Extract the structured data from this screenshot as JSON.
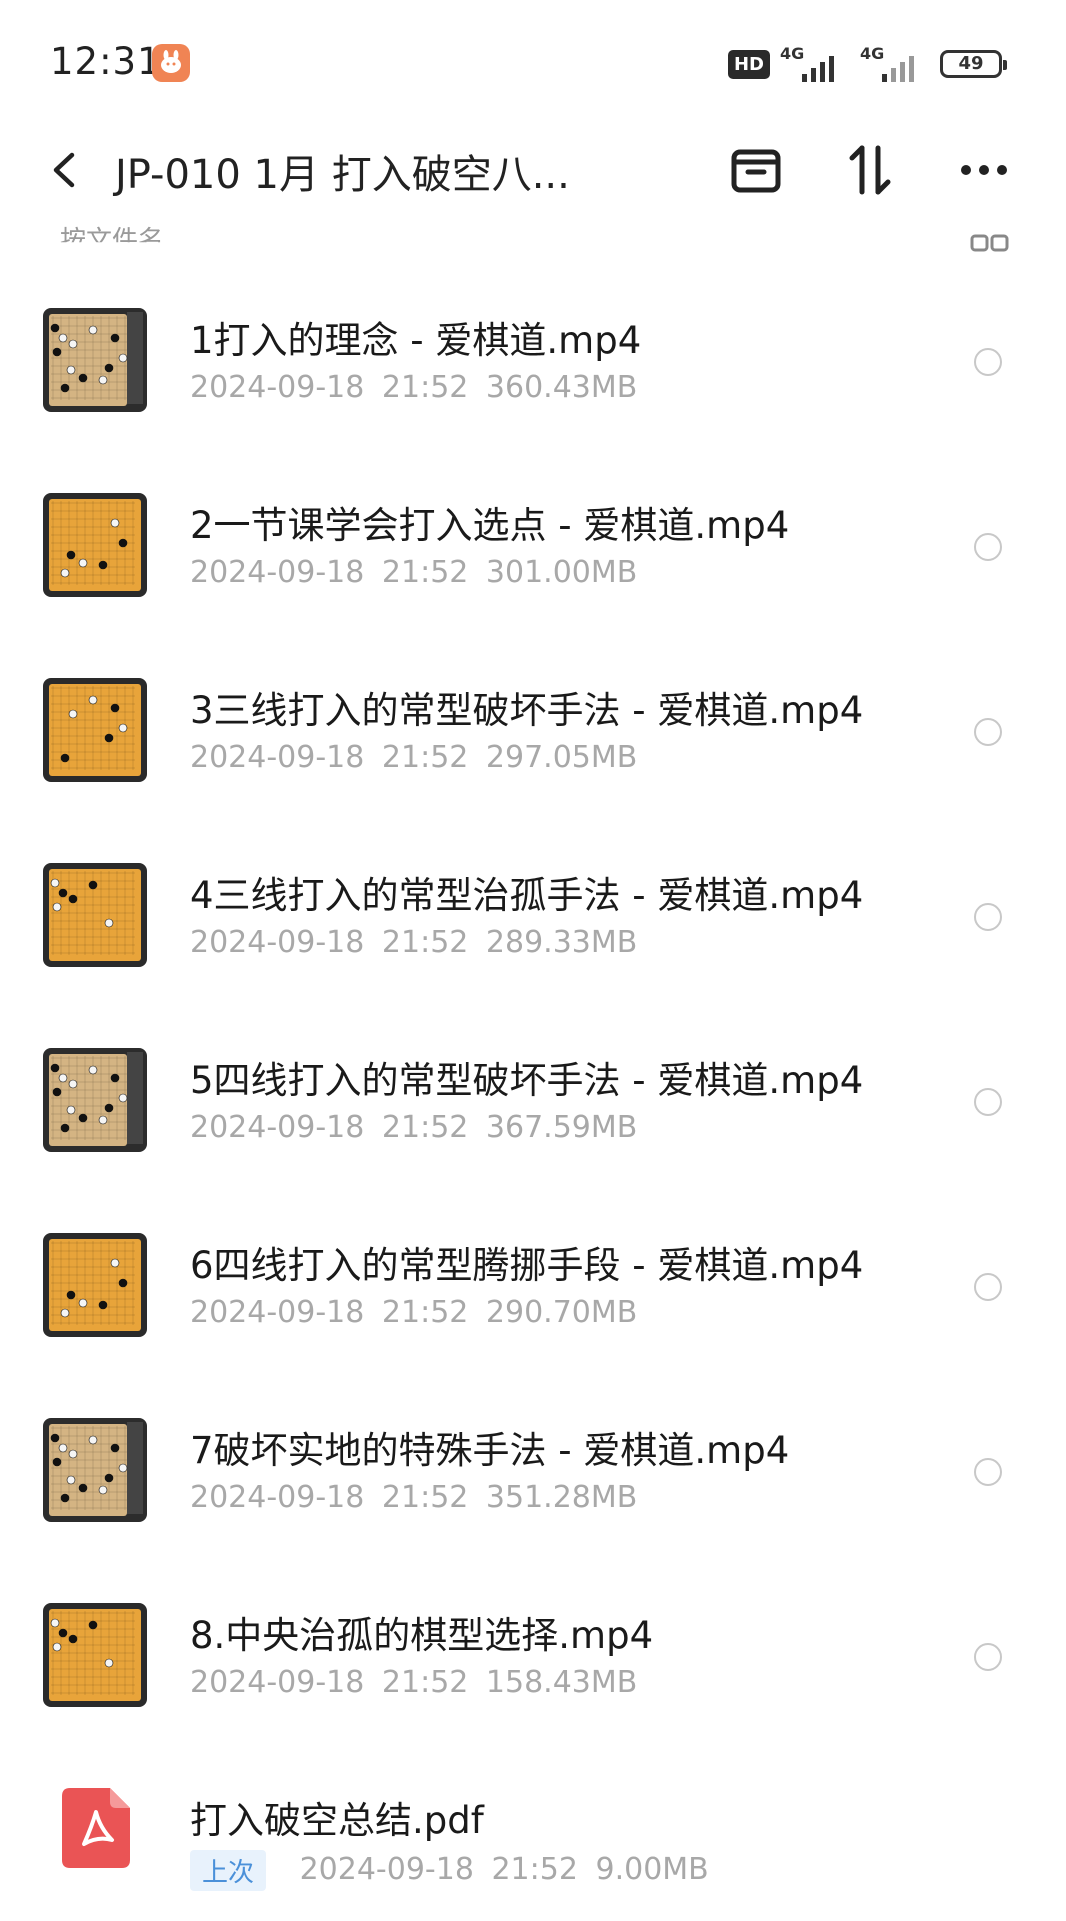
{
  "status_bar": {
    "time": "12:31",
    "hd": "HD",
    "net1": "4G",
    "net2": "4G",
    "battery": "49"
  },
  "header": {
    "title": "JP-010 1月 打入破空八..."
  },
  "sort": {
    "label": "按文件名"
  },
  "files": [
    {
      "name": "1打入的理念 - 爱棋道.mp4",
      "date": "2024-09-18",
      "time": "21:52",
      "size": "360.43MB",
      "thumb": "screen-dark"
    },
    {
      "name": "2一节课学会打入选点 - 爱棋道.mp4",
      "date": "2024-09-18",
      "time": "21:52",
      "size": "301.00MB",
      "thumb": "board-gold"
    },
    {
      "name": "3三线打入的常型破坏手法 - 爱棋道.mp4",
      "date": "2024-09-18",
      "time": "21:52",
      "size": "297.05MB",
      "thumb": "board-gold"
    },
    {
      "name": "4三线打入的常型治孤手法 - 爱棋道.mp4",
      "date": "2024-09-18",
      "time": "21:52",
      "size": "289.33MB",
      "thumb": "board-gold"
    },
    {
      "name": "5四线打入的常型破坏手法 - 爱棋道.mp4",
      "date": "2024-09-18",
      "time": "21:52",
      "size": "367.59MB",
      "thumb": "screen-dark"
    },
    {
      "name": "6四线打入的常型腾挪手段 - 爱棋道.mp4",
      "date": "2024-09-18",
      "time": "21:52",
      "size": "290.70MB",
      "thumb": "board-gold"
    },
    {
      "name": "7破坏实地的特殊手法 - 爱棋道.mp4",
      "date": "2024-09-18",
      "time": "21:52",
      "size": "351.28MB",
      "thumb": "screen-dark"
    },
    {
      "name": "8.中央治孤的棋型选择.mp4",
      "date": "2024-09-18",
      "time": "21:52",
      "size": "158.43MB",
      "thumb": "board-gold"
    }
  ],
  "pdf_file": {
    "name": "打入破空总结.pdf",
    "tag": "上次",
    "date": "2024-09-18",
    "time": "21:52",
    "size": "9.00MB"
  }
}
